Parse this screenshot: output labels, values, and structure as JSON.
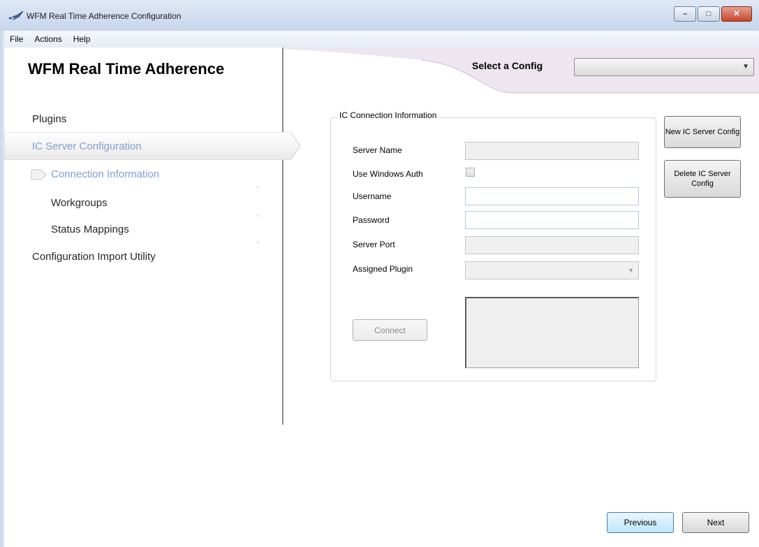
{
  "window": {
    "title": "WFM Real Time Adherence Configuration",
    "minimize_glyph": "–",
    "maximize_glyph": "□",
    "close_glyph": "✕"
  },
  "menu": [
    {
      "label": "File"
    },
    {
      "label": "Actions"
    },
    {
      "label": "Help"
    }
  ],
  "header": {
    "app_title": "WFM Real Time Adherence",
    "select_config_label": "Select a Config",
    "select_config_value": "",
    "dropdown_glyph": "▼"
  },
  "nav": {
    "plugins": "Plugins",
    "ic_server_configuration": "IC Server Configuration",
    "connection_information": "Connection Information",
    "workgroups": "Workgroups",
    "status_mappings": "Status Mappings",
    "configuration_import_utility": "Configuration Import Utility"
  },
  "connection_group": {
    "legend": "IC Connection Information",
    "server_name_label": "Server Name",
    "server_name_value": "",
    "use_windows_auth_label": "Use Windows Auth",
    "use_windows_auth_checked": false,
    "username_label": "Username",
    "username_value": "",
    "password_label": "Password",
    "password_value": "",
    "server_port_label": "Server Port",
    "server_port_value": "",
    "assigned_plugin_label": "Assigned Plugin",
    "assigned_plugin_value": "",
    "combo_glyph": "▼",
    "connect_label": "Connect"
  },
  "side_buttons": {
    "new_ic_server_config": "New IC Server Config",
    "delete_ic_server_config": "Delete IC Server Config"
  },
  "footer": {
    "previous_label": "Previous",
    "next_label": "Next"
  },
  "colors": {
    "nav_selected_text": "#7f9fd3",
    "titlebar": "#c7d6ec",
    "swoosh": "#ede6f1"
  },
  "icons": {
    "app_icon": "app-logo-icon",
    "nav_current": "arrow-right-icon"
  }
}
